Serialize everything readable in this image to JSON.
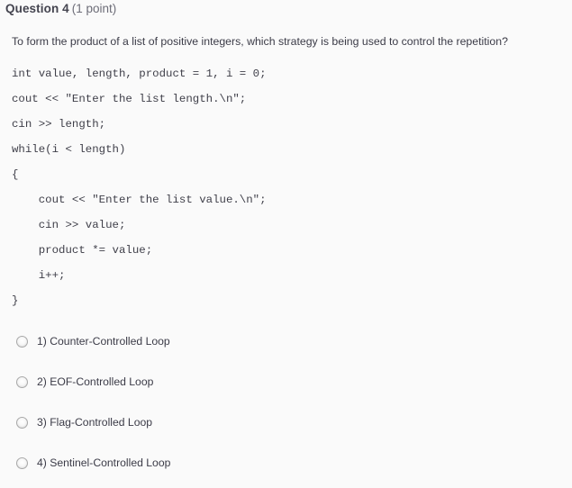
{
  "header": {
    "title": "Question 4",
    "points": "(1 point)"
  },
  "question": {
    "prompt": "To form the product of a list of positive integers, which strategy is being used to control the repetition?",
    "code_lines": [
      "int value, length, product = 1, i = 0;",
      "cout << \"Enter the list length.\\n\";",
      "cin >> length;",
      "while(i < length)",
      "{",
      "    cout << \"Enter the list value.\\n\";",
      "    cin >> value;",
      "    product *= value;",
      "    i++;",
      "}"
    ]
  },
  "answers": {
    "selected": null,
    "options": [
      {
        "number": "1)",
        "label": "1) Counter-Controlled Loop",
        "text": "Counter-Controlled Loop"
      },
      {
        "number": "2)",
        "label": "2) EOF-Controlled Loop",
        "text": "EOF-Controlled Loop"
      },
      {
        "number": "3)",
        "label": "3) Flag-Controlled Loop",
        "text": "Flag-Controlled Loop"
      },
      {
        "number": "4)",
        "label": "4) Sentinel-Controlled Loop",
        "text": "Sentinel-Controlled Loop"
      }
    ]
  },
  "colors": {
    "background": "#fafafa",
    "text": "#3b3b47",
    "header_title": "#44444f",
    "header_points": "#6d6d78",
    "radio_border": "#a9a9a9"
  }
}
